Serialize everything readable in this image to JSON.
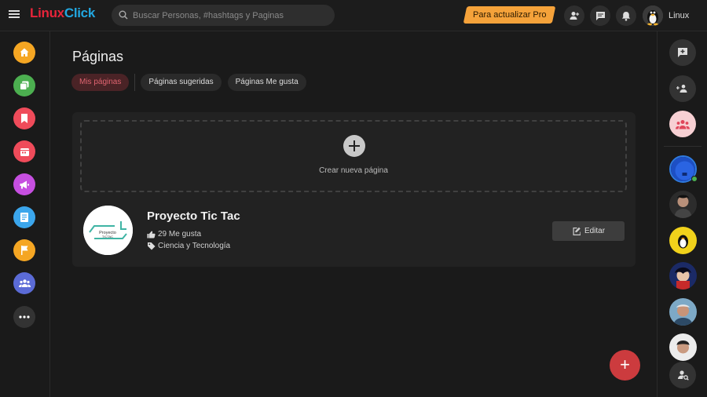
{
  "app": {
    "logo_part1": "Linux",
    "logo_part2": "Click"
  },
  "search": {
    "placeholder": "Buscar Personas, #hashtags y Paginas"
  },
  "topbar": {
    "pro_label": "Para actualizar Pro",
    "user_name": "Linux"
  },
  "main": {
    "title": "Páginas",
    "tabs": [
      {
        "label": "Mis páginas",
        "active": true
      },
      {
        "label": "Páginas sugeridas",
        "active": false
      },
      {
        "label": "Páginas Me gusta",
        "active": false
      }
    ],
    "create_label": "Crear nueva página",
    "page": {
      "name": "Proyecto Tic Tac",
      "likes": "29 Me gusta",
      "category": "Ciencia y Tecnología",
      "logo_text": "Proyecto TicTac"
    },
    "edit_label": "Editar",
    "fab_label": "+"
  },
  "left_nav": [
    {
      "icon": "home-icon",
      "color": "#f5a623"
    },
    {
      "icon": "chat-copy-icon",
      "color": "#4caf50"
    },
    {
      "icon": "bookmark-icon",
      "color": "#ef4b5a"
    },
    {
      "icon": "calendar-icon",
      "color": "#ef4b5a"
    },
    {
      "icon": "megaphone-icon",
      "color": "#c64fe0"
    },
    {
      "icon": "news-icon",
      "color": "#3ba6ec"
    },
    {
      "icon": "flag-icon",
      "color": "#f5a623"
    },
    {
      "icon": "groups-icon",
      "color": "#5b6bd6"
    },
    {
      "icon": "more-icon",
      "color": "#333333"
    }
  ],
  "colors": {
    "accent": "#cc3b3e",
    "pro": "#f5a23a",
    "online": "#4caf50"
  }
}
